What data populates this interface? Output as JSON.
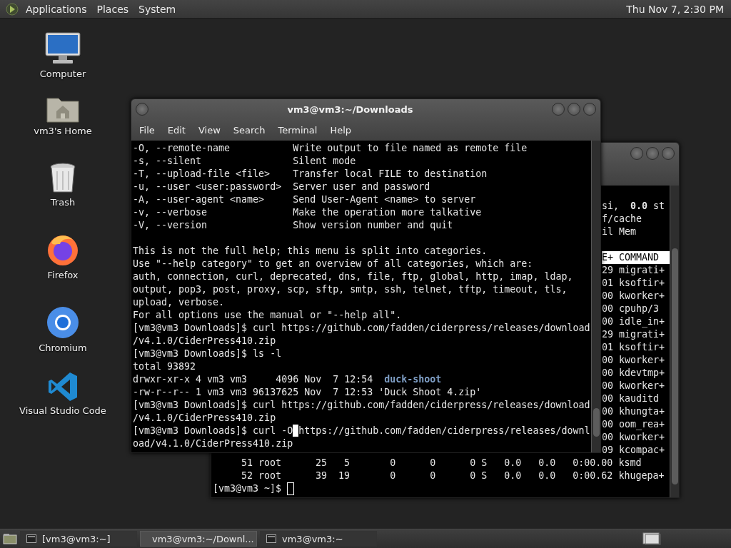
{
  "top_panel": {
    "menus": [
      "Applications",
      "Places",
      "System"
    ],
    "clock": "Thu Nov 7, 2:30 PM"
  },
  "desktop_icons": [
    {
      "label": "Computer",
      "kind": "computer"
    },
    {
      "label": "vm3's Home",
      "kind": "home"
    },
    {
      "label": "Trash",
      "kind": "trash"
    },
    {
      "label": "Firefox",
      "kind": "firefox"
    },
    {
      "label": "Chromium",
      "kind": "chromium"
    },
    {
      "label": "Visual Studio Code",
      "kind": "vscode"
    }
  ],
  "terminal_back": {
    "top_lines": [
      "si,  **0.0** st",
      "f/cache",
      "il Mem"
    ],
    "header": "E+ COMMAND",
    "process_rows": [
      "29 migrati+",
      "01 ksoftir+",
      "00 kworker+",
      "00 cpuhp/3",
      "00 idle_in+",
      "29 migrati+",
      "01 ksoftir+",
      "00 kworker+",
      "00 kdevtmp+",
      "00 kworker+",
      "00 kauditd",
      "00 khungta+",
      "00 oom_rea+",
      "00 kworker+",
      "09 kcompac+"
    ],
    "bottom_rows": [
      "     51 root      25   5       0      0      0 S   0.0   0.0   0:00.00 ksmd",
      "     52 root      39  19       0      0      0 S   0.0   0.0   0:00.62 khugepa+"
    ],
    "prompt": "[vm3@vm3 ~]$"
  },
  "terminal_front": {
    "title": "vm3@vm3:~/Downloads",
    "menu": [
      "File",
      "Edit",
      "View",
      "Search",
      "Terminal",
      "Help"
    ],
    "lines": [
      {
        "kind": "text",
        "text": "-O, --remote-name           Write output to file named as remote file"
      },
      {
        "kind": "text",
        "text": "-s, --silent                Silent mode"
      },
      {
        "kind": "text",
        "text": "-T, --upload-file <file>    Transfer local FILE to destination"
      },
      {
        "kind": "text",
        "text": "-u, --user <user:password>  Server user and password"
      },
      {
        "kind": "text",
        "text": "-A, --user-agent <name>     Send User-Agent <name> to server"
      },
      {
        "kind": "text",
        "text": "-v, --verbose               Make the operation more talkative"
      },
      {
        "kind": "text",
        "text": "-V, --version               Show version number and quit"
      },
      {
        "kind": "blank"
      },
      {
        "kind": "text",
        "text": "This is not the full help; this menu is split into categories."
      },
      {
        "kind": "text",
        "text": "Use \"--help category\" to get an overview of all categories, which are:"
      },
      {
        "kind": "text",
        "text": "auth, connection, curl, deprecated, dns, file, ftp, global, http, imap, ldap,"
      },
      {
        "kind": "text",
        "text": "output, pop3, post, proxy, scp, sftp, smtp, ssh, telnet, tftp, timeout, tls,"
      },
      {
        "kind": "text",
        "text": "upload, verbose."
      },
      {
        "kind": "text",
        "text": "For all options use the manual or \"--help all\"."
      },
      {
        "kind": "text",
        "text": "[vm3@vm3 Downloads]$ curl https://github.com/fadden/ciderpress/releases/download"
      },
      {
        "kind": "text",
        "text": "/v4.1.0/CiderPress410.zip"
      },
      {
        "kind": "text",
        "text": "[vm3@vm3 Downloads]$ ls -l"
      },
      {
        "kind": "text",
        "text": "total 93892"
      },
      {
        "kind": "dir",
        "text": "drwxr-xr-x 4 vm3 vm3     4096 Nov  7 12:54  ",
        "name": "duck-shoot"
      },
      {
        "kind": "text",
        "text": "-rw-r--r-- 1 vm3 vm3 96137625 Nov  7 12:53 'Duck Shoot 4.zip'"
      },
      {
        "kind": "text",
        "text": "[vm3@vm3 Downloads]$ curl https://github.com/fadden/ciderpress/releases/download"
      },
      {
        "kind": "text",
        "text": "/v4.1.0/CiderPress410.zip"
      },
      {
        "kind": "cursor",
        "text": "[vm3@vm3 Downloads]$ curl -O",
        "after": "https://github.com/fadden/ciderpress/releases/downl"
      },
      {
        "kind": "text",
        "text": "oad/v4.1.0/CiderPress410.zip"
      }
    ]
  },
  "taskbar": {
    "items": [
      {
        "label": "[vm3@vm3:~]",
        "selected": false
      },
      {
        "label": "vm3@vm3:~/Downl...",
        "selected": true
      },
      {
        "label": "vm3@vm3:~",
        "selected": false
      }
    ]
  }
}
